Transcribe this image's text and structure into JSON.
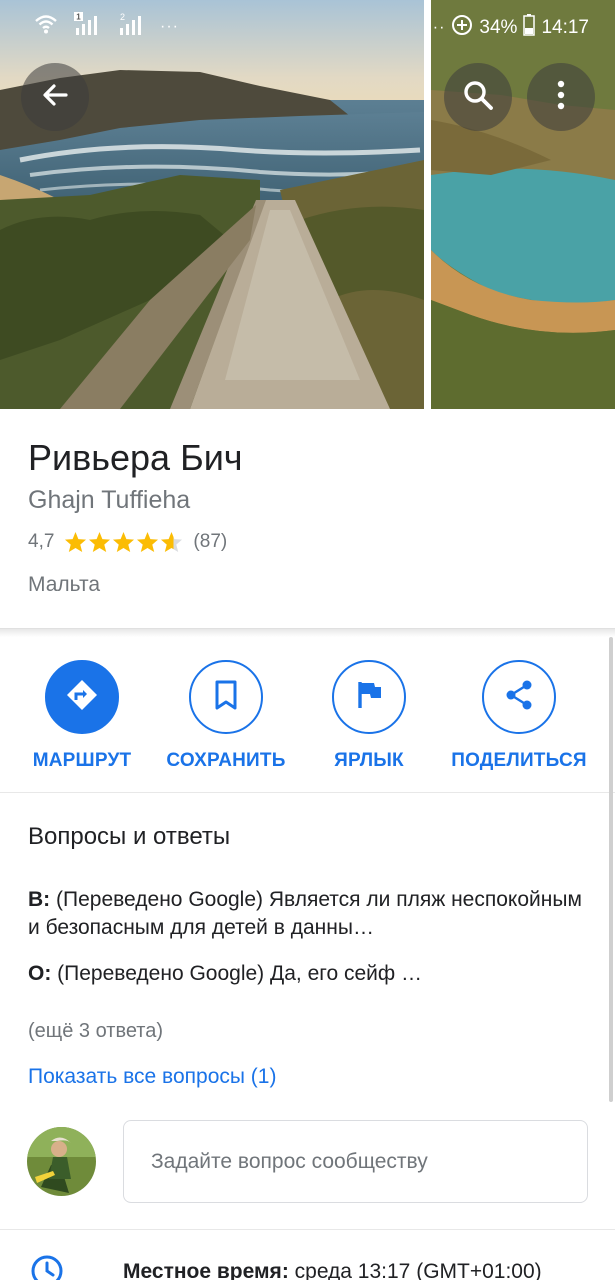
{
  "status_bar": {
    "left_dots": "···",
    "right_dots": "···",
    "battery": "34%",
    "time": "14:17",
    "sim1": "1",
    "sim2": "2"
  },
  "header_buttons": {
    "back_icon": "arrow-left-icon",
    "search_icon": "search-icon",
    "more_icon": "more-vert-icon"
  },
  "place": {
    "title": "Ривьера Бич",
    "subtitle": "Ghajn Tuffieha",
    "rating": "4,7",
    "rating_value": 4.7,
    "review_count": "(87)",
    "country": "Мальта"
  },
  "actions": [
    {
      "label": "МАРШРУТ",
      "icon": "directions-icon"
    },
    {
      "label": "СОХРАНИТЬ",
      "icon": "bookmark-icon"
    },
    {
      "label": "ЯРЛЫК",
      "icon": "flag-icon"
    },
    {
      "label": "ПОДЕЛИТЬСЯ",
      "icon": "share-icon"
    }
  ],
  "qa": {
    "title": "Вопросы и ответы",
    "q_prefix": "В:",
    "question": " (Переведено Google) Является ли пляж неспокойным и безопасным для детей в данны…",
    "a_prefix": "О:",
    "answer": " (Переведено Google) Да, его сейф …",
    "more_answers": "(ещё 3 ответа)",
    "show_all": "Показать все вопросы (1)",
    "ask_placeholder": "Задайте вопрос сообществу"
  },
  "local_time": {
    "label": "Местное время:",
    "value": " среда 13:17 (GMT+01:00)"
  },
  "colors": {
    "accent": "#1a73e8",
    "star": "#fbbc04",
    "secondary_text": "#70757a"
  }
}
